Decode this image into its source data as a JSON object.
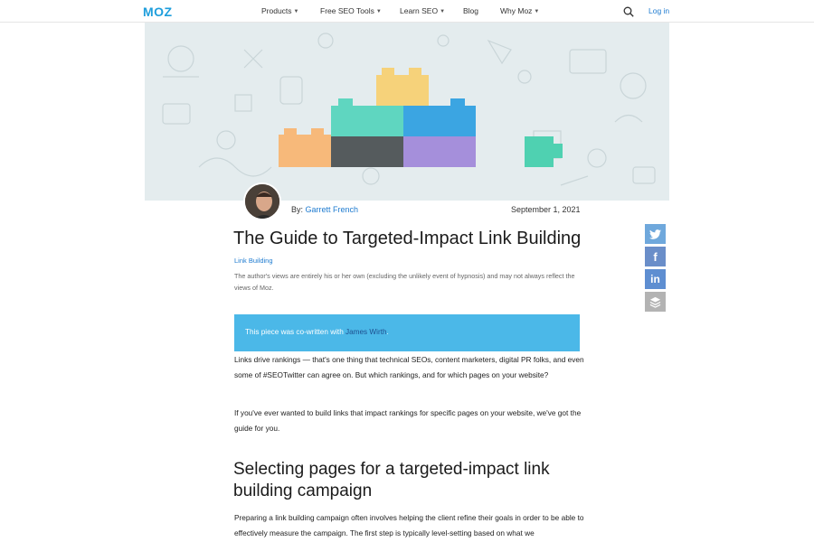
{
  "nav": {
    "logo": "MOZ",
    "items": [
      {
        "label": "Products",
        "has_dropdown": true
      },
      {
        "label": "Free SEO Tools",
        "has_dropdown": true
      },
      {
        "label": "Learn SEO",
        "has_dropdown": true
      },
      {
        "label": "Blog",
        "has_dropdown": false
      },
      {
        "label": "Why Moz",
        "has_dropdown": true
      }
    ],
    "login": "Log in",
    "search_icon": "search-icon"
  },
  "article": {
    "byline_prefix": "By:",
    "author": "Garrett French",
    "date": "September 1, 2021",
    "title": "The Guide to Targeted-Impact Link Building",
    "category": "Link Building",
    "disclaimer": "The author's views are entirely his or her own (excluding the unlikely event of hypnosis) and may not always reflect the views of Moz.",
    "callout_prefix": "This piece was co-written with",
    "callout_author": "James Wirth",
    "callout_suffix": ".",
    "paragraph1": "Links drive rankings — that's one thing that technical SEOs, content marketers, digital PR folks, and even some of #SEOTwitter can agree on. But which rankings, and for which pages on your website?",
    "paragraph2": "If you've ever wanted to build links that impact rankings for specific pages on your website, we've got the guide for you.",
    "heading2": "Selecting pages for a targeted-impact link building campaign",
    "paragraph3": "Preparing a link building campaign often involves helping the client refine their goals in order to be able to effectively measure the campaign. The first step is typically level-setting based on what we"
  },
  "social": {
    "twitter_icon": "twitter-icon",
    "facebook_icon": "facebook-icon",
    "linkedin_icon": "linkedin-icon",
    "buffer_icon": "buffer-icon"
  },
  "colors": {
    "brand": "#1e9edc",
    "link": "#1e7bd0",
    "callout_bg": "#4bb8e8",
    "hero_bg": "#e4ecee"
  }
}
